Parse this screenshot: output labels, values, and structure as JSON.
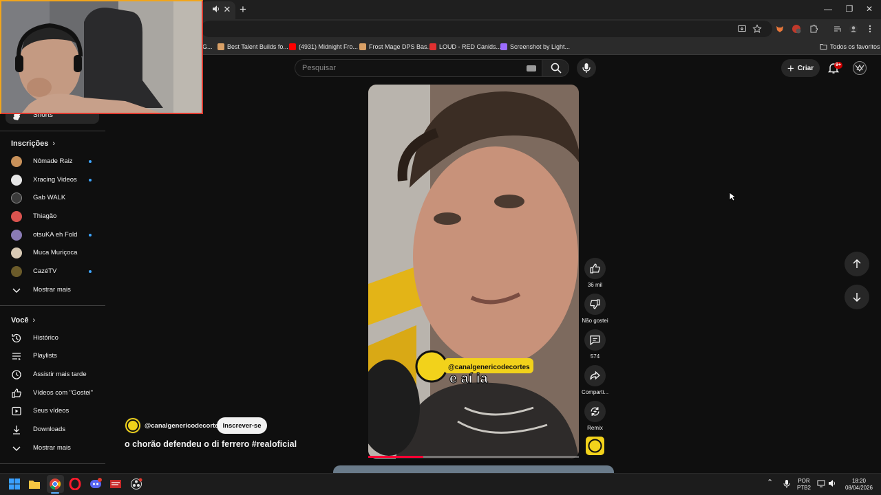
{
  "browser": {
    "bookmarks": [
      {
        "label": "Best Talent Builds fo...",
        "icon_color": "#d9a066"
      },
      {
        "label": "(4931) Midnight Fro...",
        "icon_color": "#ff0000"
      },
      {
        "label": "Frost Mage DPS Bas...",
        "icon_color": "#d9a066"
      },
      {
        "label": "LOUD - RED Canids...",
        "icon_color": "#e03030"
      },
      {
        "label": "Screenshot by Light...",
        "icon_color": "#9b6cff"
      }
    ],
    "bookmarks_partial_left": "G...",
    "all_bookmarks": "Todos os favoritos"
  },
  "header": {
    "search_placeholder": "Pesquisar",
    "create_label": "Criar",
    "notif_badge": "9+"
  },
  "sidebar": {
    "shorts_label": "Shorts",
    "subscriptions_title": "Inscrições",
    "subscriptions": [
      {
        "name": "Nômade Raiz",
        "new": true,
        "color": "#c8915a"
      },
      {
        "name": "Xracing Videos",
        "new": true,
        "color": "#e6e6e6"
      },
      {
        "name": "Gab WALK",
        "new": false,
        "color": "#3a3a3a"
      },
      {
        "name": "Thiagão",
        "new": false,
        "color": "#d9534f"
      },
      {
        "name": "otsuKA eh Fold",
        "new": true,
        "color": "#8a7bb5"
      },
      {
        "name": "Muca Muriçoca",
        "new": false,
        "color": "#d8c9b5"
      },
      {
        "name": "CazéTV",
        "new": true,
        "color": "#6b5b2a"
      }
    ],
    "show_more_subs": "Mostrar mais",
    "you_title": "Você",
    "you_items": [
      {
        "label": "Histórico",
        "icon": "history-icon"
      },
      {
        "label": "Playlists",
        "icon": "playlists-icon"
      },
      {
        "label": "Assistir mais tarde",
        "icon": "clock-icon"
      },
      {
        "label": "Vídeos com \"Gostei\"",
        "icon": "thumbs-up-icon"
      },
      {
        "label": "Seus vídeos",
        "icon": "play-square-icon"
      },
      {
        "label": "Downloads",
        "icon": "download-icon"
      }
    ],
    "show_more_you": "Mostrar mais"
  },
  "short": {
    "caption": "e aí ia",
    "watermark": "@canalgenericodecortes",
    "channel_name": "@canalgenericodecorte",
    "subscribe_label": "Inscrever-se",
    "title": "o chorão defendeu o di ferrero #realoficial",
    "progress": 0.26,
    "actions": {
      "like_count": "36 mil",
      "dislike_label": "Não gostei",
      "comments_count": "574",
      "share_label": "Comparti...",
      "remix_label": "Remix"
    }
  },
  "taskbar": {
    "lang_top": "POR",
    "lang_bottom": "PTB2",
    "time": "18:20",
    "date": "08/04/2026"
  }
}
